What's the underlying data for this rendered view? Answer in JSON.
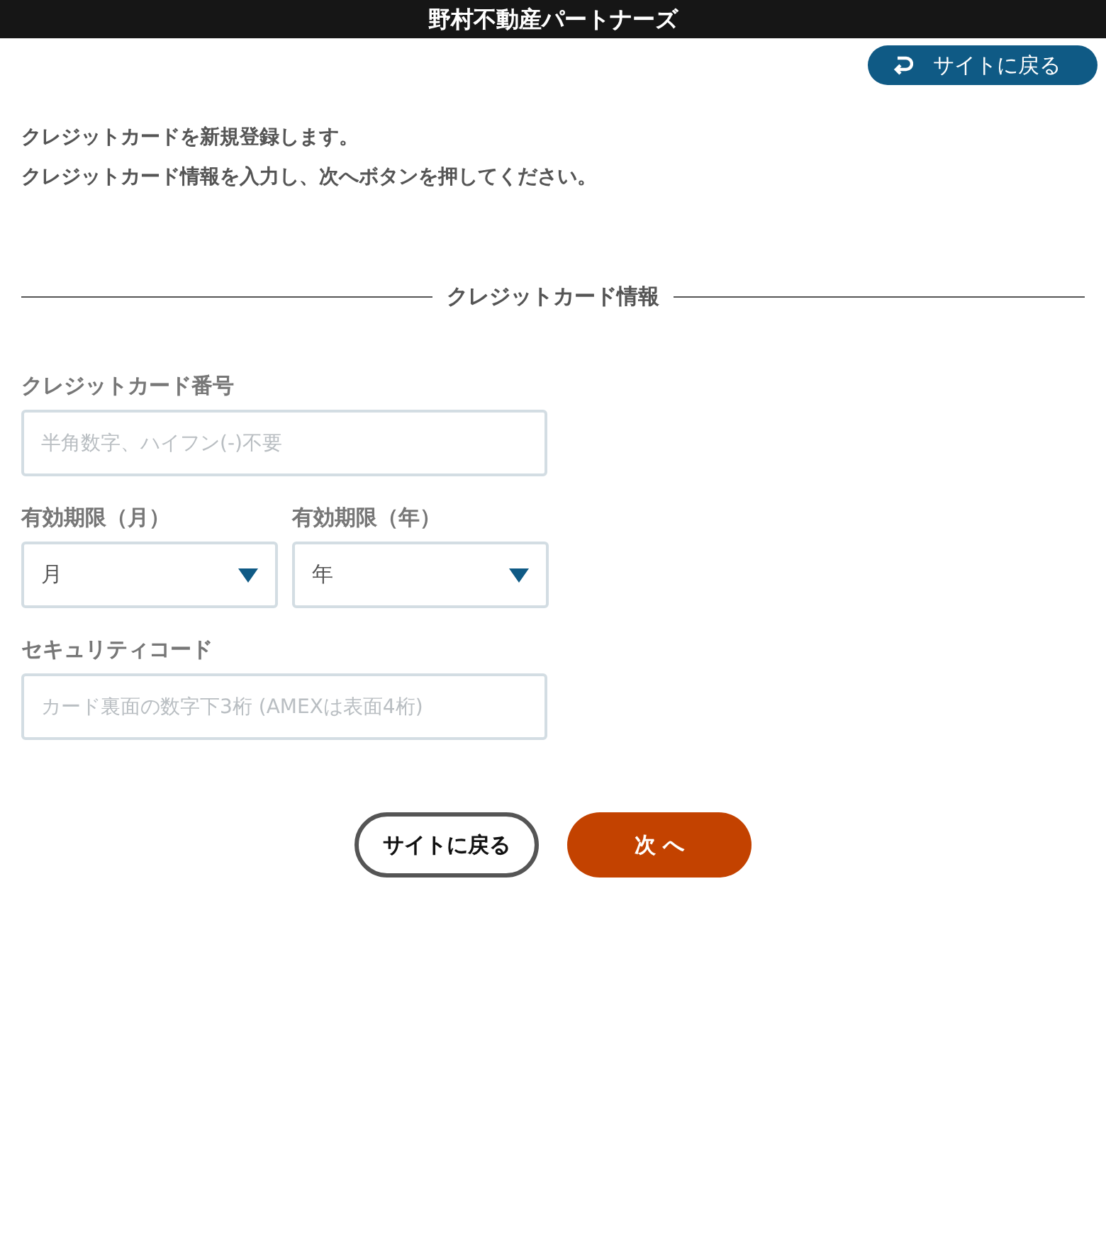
{
  "header": {
    "title": "野村不動産パートナーズ"
  },
  "back_link": {
    "label": "サイトに戻る"
  },
  "intro": [
    "クレジットカードを新規登録します。",
    "クレジットカード情報を入力し、次へボタンを押してください。"
  ],
  "section": {
    "title": "クレジットカード情報"
  },
  "fields": [
    {
      "kind": "text",
      "label": "クレジットカード番号",
      "placeholder": "半角数字、ハイフン(-)不要"
    },
    {
      "kind": "selects",
      "items": [
        {
          "label": "有効期限（月）",
          "value": "月"
        },
        {
          "label": "有効期限（年）",
          "value": "年"
        }
      ]
    },
    {
      "kind": "text",
      "label": "セキュリティコード",
      "placeholder": "カード裏面の数字下3桁 (AMEXは表面4桁)"
    }
  ],
  "buttons": [
    {
      "kind": "outline",
      "label": "サイトに戻る"
    },
    {
      "kind": "primary",
      "label": "次 へ"
    }
  ]
}
